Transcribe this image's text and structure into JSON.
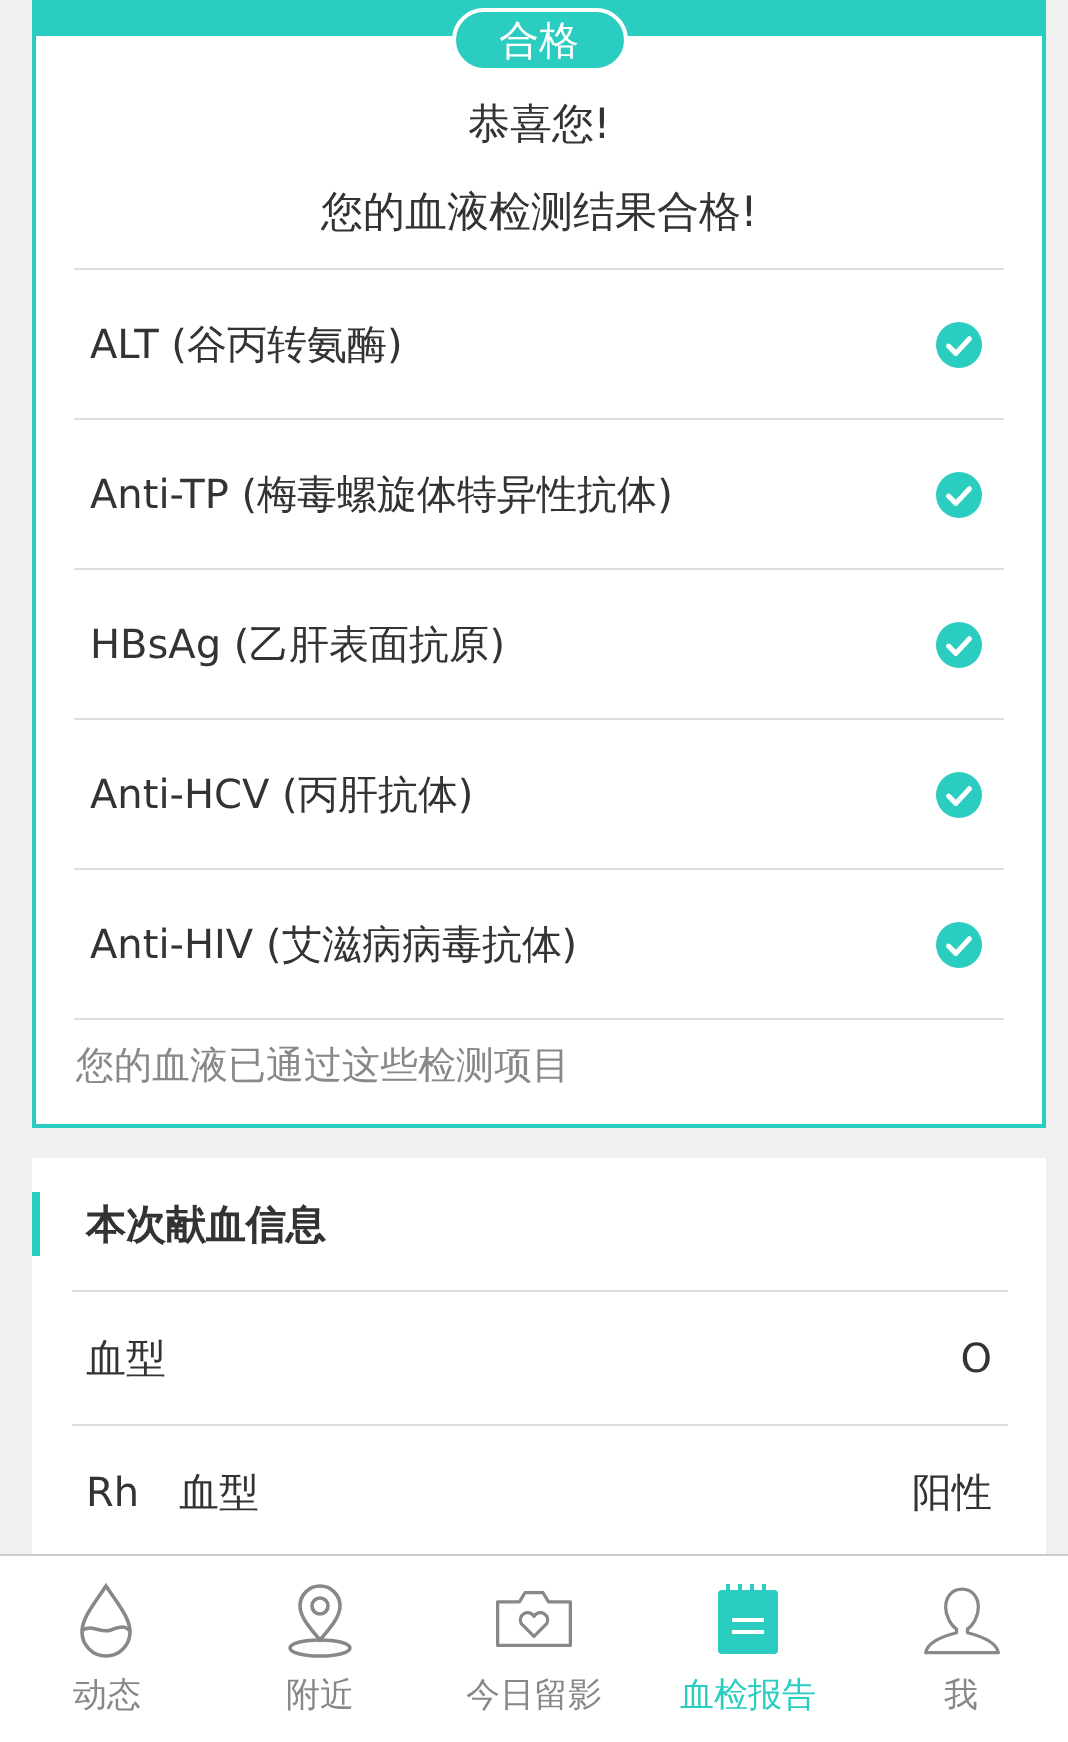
{
  "result_card": {
    "badge": "合格",
    "greeting": "恭喜您!",
    "message": "您的血液检测结果合格!",
    "tests": [
      {
        "name": "ALT (谷丙转氨酶)",
        "passed": true
      },
      {
        "name": "Anti-TP (梅毒螺旋体特异性抗体)",
        "passed": true
      },
      {
        "name": "HBsAg (乙肝表面抗原)",
        "passed": true
      },
      {
        "name": "Anti-HCV (丙肝抗体)",
        "passed": true
      },
      {
        "name": "Anti-HIV (艾滋病病毒抗体)",
        "passed": true
      }
    ],
    "footer": "您的血液已通过这些检测项目"
  },
  "donation_info": {
    "title": "本次献血信息",
    "rows": [
      {
        "label": "血型",
        "value": "O"
      },
      {
        "label": "Rh　血型",
        "value": "阳性"
      }
    ]
  },
  "tab_bar": [
    {
      "kind": "drop",
      "label": "动态",
      "selected": false
    },
    {
      "kind": "pin",
      "label": "附近",
      "selected": false
    },
    {
      "kind": "camera",
      "label": "今日留影",
      "selected": false
    },
    {
      "kind": "report",
      "label": "血检报告",
      "selected": true
    },
    {
      "kind": "person",
      "label": "我",
      "selected": false
    }
  ]
}
